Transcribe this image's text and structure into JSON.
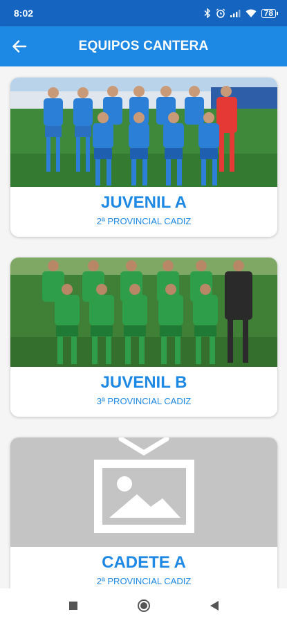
{
  "status_bar": {
    "time": "8:02",
    "battery": "78",
    "icons": [
      "bluetooth-icon",
      "alarm-icon",
      "signal-icon",
      "wifi-icon",
      "battery-icon"
    ]
  },
  "app_bar": {
    "title": "EQUIPOS CANTERA",
    "back_icon": "arrow-left-icon"
  },
  "teams": [
    {
      "name": "JUVENIL A",
      "league": "2ª PROVINCIAL CADIZ",
      "kit": "blue"
    },
    {
      "name": "JUVENIL B",
      "league": "3ª PROVINCIAL CADIZ",
      "kit": "green"
    },
    {
      "name": "CADETE A",
      "league": "2ª PROVINCIAL CADIZ",
      "kit": "placeholder"
    }
  ],
  "colors": {
    "status_bar": "#1565c0",
    "app_bar": "#1e88e5",
    "accent_text": "#1e88e5",
    "background": "#f5f5f5",
    "placeholder_bg": "#c4c4c4"
  },
  "nav": [
    "square-icon",
    "home-circle-icon",
    "back-triangle-icon"
  ]
}
